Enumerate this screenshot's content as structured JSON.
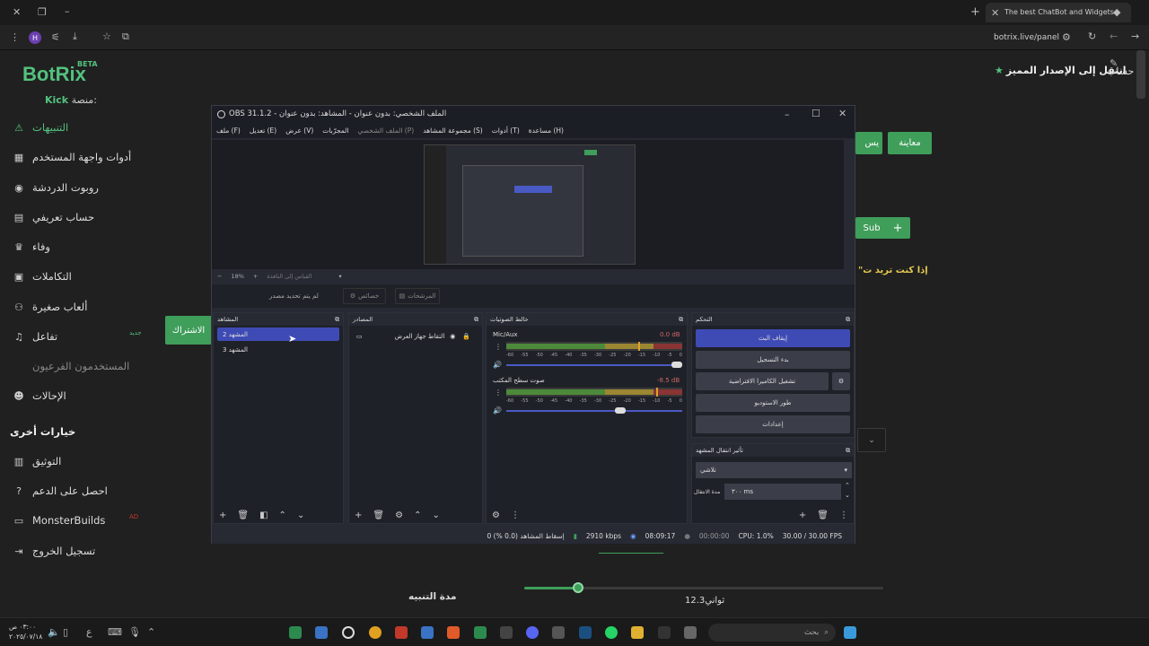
{
  "browser": {
    "tab_title": "The best ChatBot and Widgets",
    "url": "botrix.live/panel",
    "profile_initial": "H"
  },
  "site": {
    "logo": "BotRix",
    "beta": "BETA",
    "platform_label": "منصة:",
    "platform_value": "Kick",
    "account": "حساب",
    "upgrade": "انتقل إلى الإصدار المميز"
  },
  "sidebar": {
    "items": [
      {
        "label": "التنبيهات",
        "icon": "warning-icon"
      },
      {
        "label": "أدوات واجهة المستخدم",
        "icon": "grid-icon"
      },
      {
        "label": "روبوت الدردشة",
        "icon": "robot-icon"
      },
      {
        "label": "حساب تعريفي",
        "icon": "id-card-icon"
      },
      {
        "label": "وفاء",
        "icon": "trophy-icon"
      },
      {
        "label": "التكاملات",
        "icon": "integration-icon"
      },
      {
        "label": "ألعاب صغيرة",
        "icon": "gamepad-icon"
      },
      {
        "label": "تفاعل",
        "icon": "music-icon"
      },
      {
        "label": "المستخدمون الفرعيون",
        "icon": "users-icon"
      },
      {
        "label": "الإحالات",
        "icon": "referral-icon"
      }
    ],
    "tag_new": "جديد",
    "section_title": "خيارات أخرى",
    "other": [
      {
        "label": "التوثيق",
        "icon": "book-icon"
      },
      {
        "label": "احصل على الدعم",
        "icon": "help-icon"
      },
      {
        "label": "MonsterBuilds",
        "icon": "monitor-icon"
      },
      {
        "label": "تسجيل الخروج",
        "icon": "logout-icon"
      }
    ],
    "tag_ad": "AD"
  },
  "main": {
    "preview_button": "معاينة",
    "save_button_partial": "يس",
    "sub_button": "Sub",
    "quote_partial": "\"إذا كنت تريد ت",
    "subscribe_button": "الاشتراك",
    "duration_label": "مدة التنبيه",
    "duration_value": "ثواني12.3",
    "slider_value": 0.15
  },
  "obs": {
    "title": "OBS 31.1.2 - الملف الشخصي: بدون عنوان - المشاهد: بدون عنوان",
    "menu": [
      "ملف (F)",
      "تعديل (E)",
      "عرض (V)",
      "المجرّبات",
      "الملف الشخصي (P)",
      "مجموعة المشاهد (S)",
      "أدوات (T)",
      "مساعدة (H)"
    ],
    "zoom": "18%",
    "zoom_hint": "القياس إلى النافذة",
    "no_source": "لم يتم تحديد مصدر",
    "properties": "خصائص",
    "filters": "المرشحات",
    "docks": {
      "scenes": "المشاهد",
      "sources": "المصادر",
      "mixer": "خالط الصوتيات",
      "controls": "التحكم",
      "transitions": "تأثير انتقال المشهد"
    },
    "scenes": [
      "المشهد 2",
      "المشهد 3"
    ],
    "sources": [
      "التقاط جهاز العرض"
    ],
    "mixer": [
      {
        "name": "Mic/Aux",
        "db": "0.0 dB",
        "level": 0.75,
        "volume": 1.0
      },
      {
        "name": "صوت سطح المكتب",
        "db": "-8.5 dB",
        "level": 0.85,
        "volume": 0.66
      }
    ],
    "meter_ticks": [
      "-60",
      "-55",
      "-50",
      "-45",
      "-40",
      "-35",
      "-30",
      "-25",
      "-20",
      "-15",
      "-10",
      "-5",
      "0"
    ],
    "controls": [
      "إيقاف البث",
      "بدء التسجيل",
      "تشغيل الكاميرا الافتراضية",
      "طور الاستوديو",
      "إعدادات"
    ],
    "transition": "تلاشي",
    "duration_label": "مدة الانتقال",
    "duration_value": "٣٠٠ ms",
    "status": {
      "dropped": "إسقاط المشاهد (0.0 %) 0",
      "bitrate": "2910 kbps",
      "live_time": "08:09:17",
      "rec_time": "00:00:00",
      "cpu": "CPU: 1.0%",
      "fps": "30.00 / 30.00 FPS"
    }
  },
  "taskbar": {
    "time": "٠٣:٠٠ ص",
    "date": "٢٠٢٥/٠٧/١٨",
    "search": "بحث",
    "lang": "ع"
  },
  "colors": {
    "accent_green": "#3f9e5a",
    "obs_blue": "#3f4bb4"
  }
}
